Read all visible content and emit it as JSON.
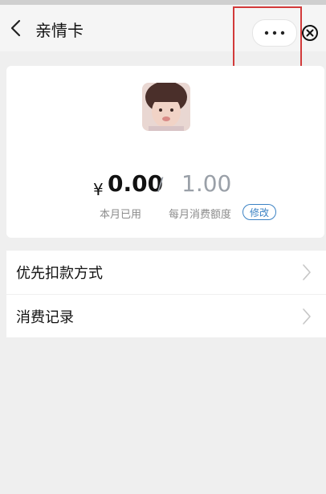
{
  "nav": {
    "title": "亲情卡",
    "more_label": "•••"
  },
  "card": {
    "currency": "¥",
    "used": "0.00",
    "separator": "/",
    "quota": "1.00",
    "used_label": "本月已用",
    "quota_label": "每月消费额度",
    "edit_label": "修改"
  },
  "list": {
    "items": [
      {
        "label": "优先扣款方式"
      },
      {
        "label": "消费记录"
      }
    ]
  },
  "colors": {
    "accent_blue": "#3b82c4",
    "highlight_red": "#d23a3a",
    "background": "#efefef"
  }
}
